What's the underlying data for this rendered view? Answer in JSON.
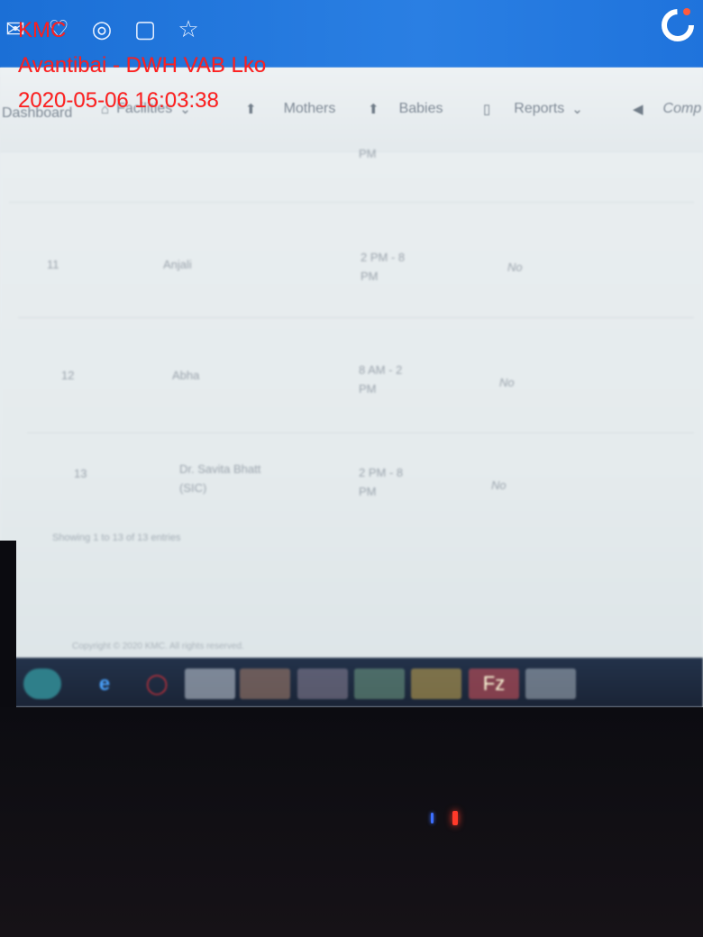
{
  "overlay": {
    "app": "KMC",
    "facility": "Avantibai - DWH VAB Lko",
    "timestamp": "2020-05-06 16:03:38"
  },
  "nav": {
    "dashboard": "Dashboard",
    "facilities": "Facilities",
    "mothers": "Mothers",
    "babies": "Babies",
    "reports": "Reports",
    "comp": "Comp"
  },
  "table": {
    "partial_top": "PM",
    "rows": [
      {
        "no": "11",
        "name": "Anjali",
        "shift": "2 PM - 8 PM",
        "flag": "No"
      },
      {
        "no": "12",
        "name": "Abha",
        "shift": "8 AM - 2 PM",
        "flag": "No"
      },
      {
        "no": "13",
        "name": "Dr. Savita Bhatt (SIC)",
        "shift": "2 PM - 8 PM",
        "flag": "No"
      }
    ],
    "showing": "Showing 1 to 13 of 13 entries"
  },
  "footer": {
    "copyright": "Copyright © 2020 KMC. All rights reserved."
  },
  "colors": {
    "header_blue": "#1b6fd6",
    "overlay_red": "#ff2020"
  }
}
